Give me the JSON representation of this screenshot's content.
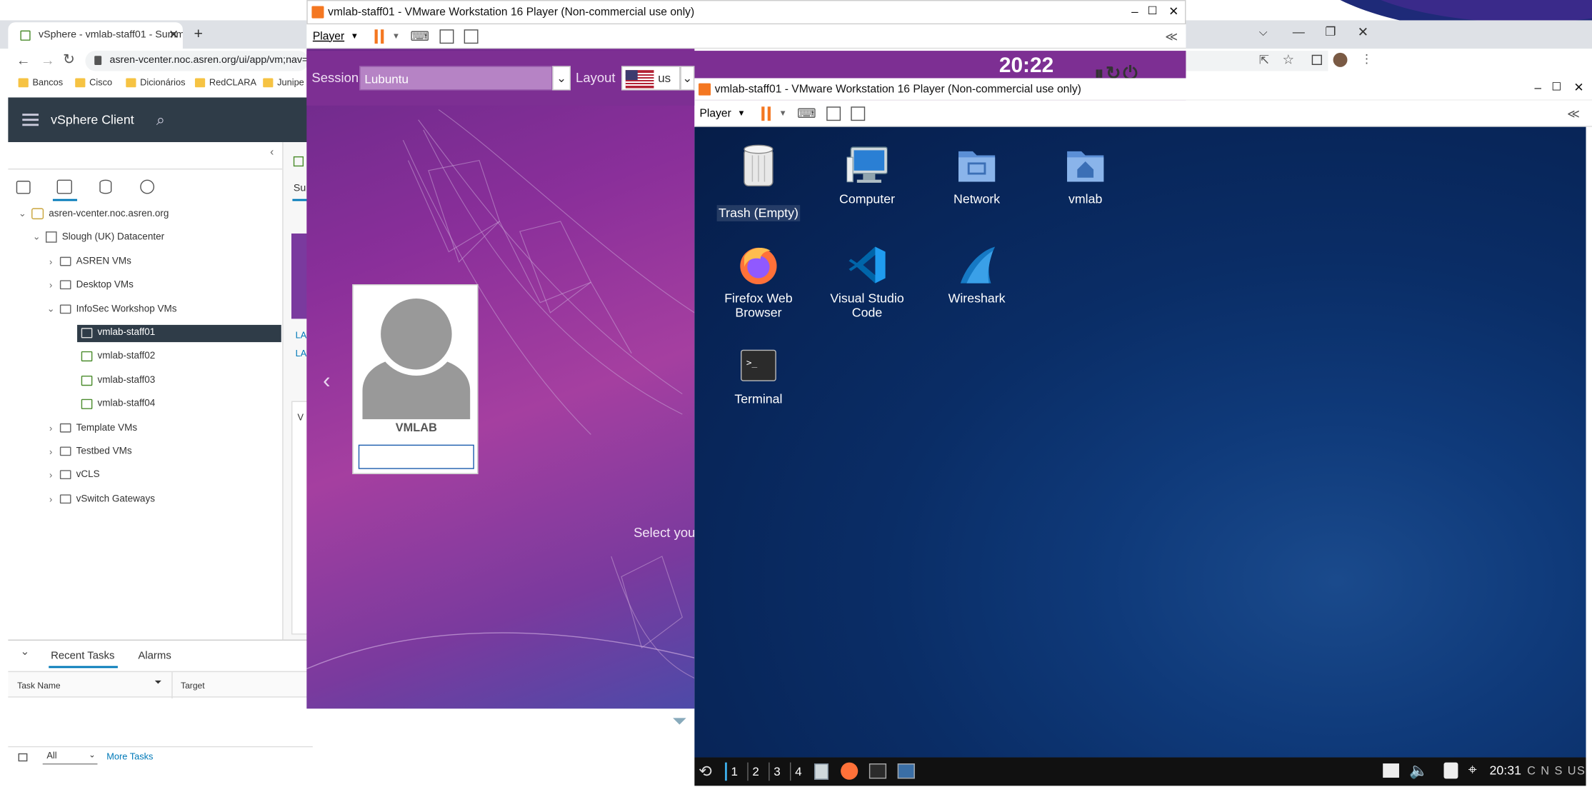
{
  "chrome": {
    "tab_title": "vSphere - vmlab-staff01 - Summ",
    "url": "asren-vcenter.noc.asren.org/ui/app/vm;nav=",
    "bookmarks": [
      "Bancos",
      "Cisco",
      "Dicionários",
      "RedCLARA",
      "Junipe"
    ]
  },
  "vsphere": {
    "app_title": "vSphere Client",
    "summary_tab": "Su",
    "side_links": [
      "LA",
      "LA"
    ],
    "side_v": "V",
    "tree": {
      "root": "asren-vcenter.noc.asren.org",
      "datacenter": "Slough (UK) Datacenter",
      "folders_top": [
        "ASREN VMs",
        "Desktop VMs",
        "InfoSec Workshop VMs"
      ],
      "vms": [
        "vmlab-staff01",
        "vmlab-staff02",
        "vmlab-staff03",
        "vmlab-staff04"
      ],
      "folders_bottom": [
        "Template VMs",
        "Testbed VMs",
        "vCLS",
        "vSwitch Gateways"
      ]
    },
    "bottom": {
      "tabs": [
        "Recent Tasks",
        "Alarms"
      ],
      "columns": [
        "Task Name",
        "Target"
      ],
      "filter_value": "All",
      "more_tasks": "More Tasks"
    }
  },
  "vm1": {
    "title": "vmlab-staff01 - VMware Workstation 16 Player (Non-commercial use only)",
    "player_menu": "Player",
    "session_label": "Session",
    "session_value": "Lubuntu",
    "layout_label": "Layout",
    "layout_value": "us",
    "clock": "20:22",
    "user_name": "VMLAB",
    "select_text": "Select you"
  },
  "vm2": {
    "title": "vmlab-staff01 - VMware Workstation 16 Player (Non-commercial use only)",
    "player_menu": "Player",
    "desktop_icons": [
      {
        "label": "Trash (Empty)",
        "icon": "trash-icon"
      },
      {
        "label": "Computer",
        "icon": "computer-icon"
      },
      {
        "label": "Network",
        "icon": "network-folder-icon"
      },
      {
        "label": "vmlab",
        "icon": "home-folder-icon"
      },
      {
        "label": "Firefox Web Browser",
        "icon": "firefox-icon"
      },
      {
        "label": "Visual Studio Code",
        "icon": "vscode-icon"
      },
      {
        "label": "Wireshark",
        "icon": "wireshark-icon"
      },
      {
        "label": "Terminal",
        "icon": "terminal-icon"
      }
    ],
    "taskbar": {
      "workspaces": [
        "1",
        "2",
        "3",
        "4"
      ],
      "clock": "20:31",
      "indicators": "C N S US"
    }
  },
  "colors": {
    "vsphere_header": "#2f3c48",
    "vmware_orange": "#f47721",
    "greeter_purple": "#7d2f93",
    "desktop_blue": "#0a2d66"
  }
}
